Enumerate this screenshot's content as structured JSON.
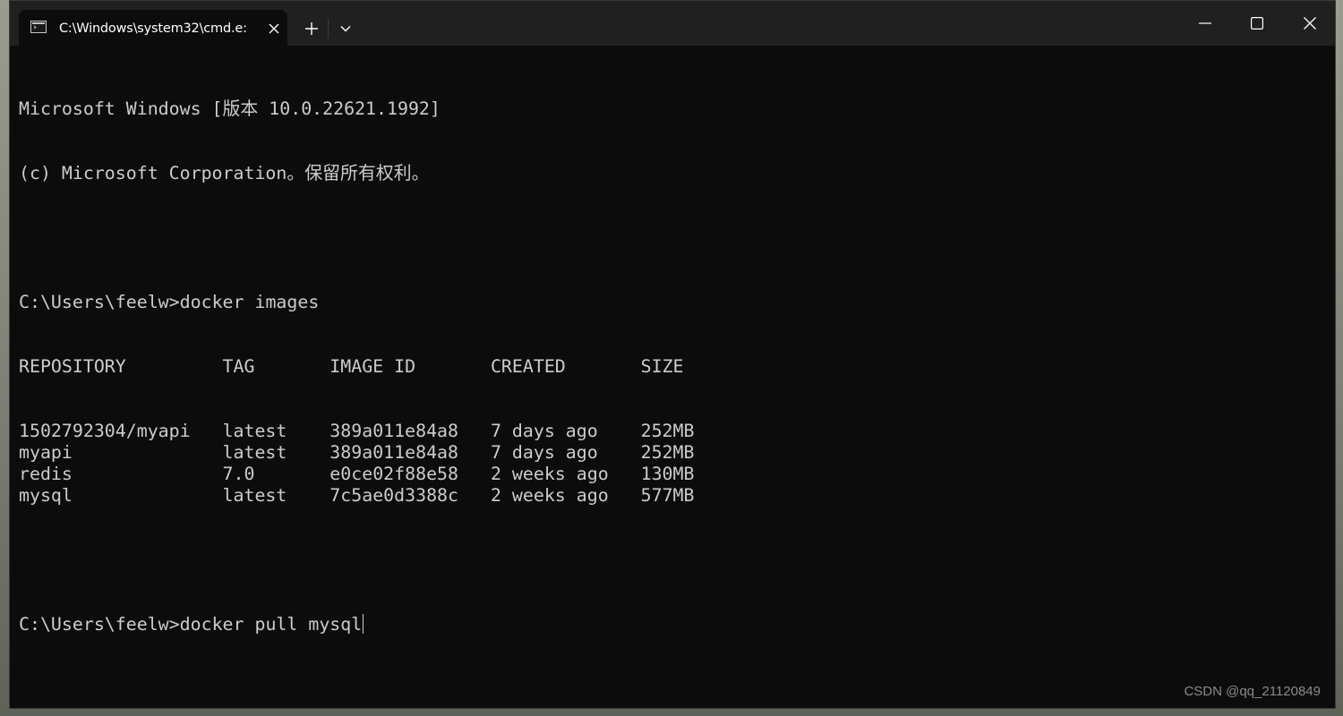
{
  "window": {
    "tab_title": "C:\\Windows\\system32\\cmd.e:",
    "tab_icon": "cmd-icon"
  },
  "console": {
    "header_lines": [
      "Microsoft Windows [版本 10.0.22621.1992]",
      "(c) Microsoft Corporation。保留所有权利。"
    ],
    "prompt": "C:\\Users\\feelw>",
    "command1": "docker images",
    "table": {
      "columns": [
        "REPOSITORY",
        "TAG",
        "IMAGE ID",
        "CREATED",
        "SIZE"
      ],
      "rows": [
        [
          "1502792304/myapi",
          "latest",
          "389a011e84a8",
          "7 days ago",
          "252MB"
        ],
        [
          "myapi",
          "latest",
          "389a011e84a8",
          "7 days ago",
          "252MB"
        ],
        [
          "redis",
          "7.0",
          "e0ce02f88e58",
          "2 weeks ago",
          "130MB"
        ],
        [
          "mysql",
          "latest",
          "7c5ae0d3388c",
          "2 weeks ago",
          "577MB"
        ]
      ]
    },
    "command2": "docker pull mysql"
  },
  "watermark": "CSDN @qq_21120849",
  "colors": {
    "console_bg": "#0c0c0c",
    "console_fg": "#cccccc",
    "titlebar_bg": "#202020"
  }
}
